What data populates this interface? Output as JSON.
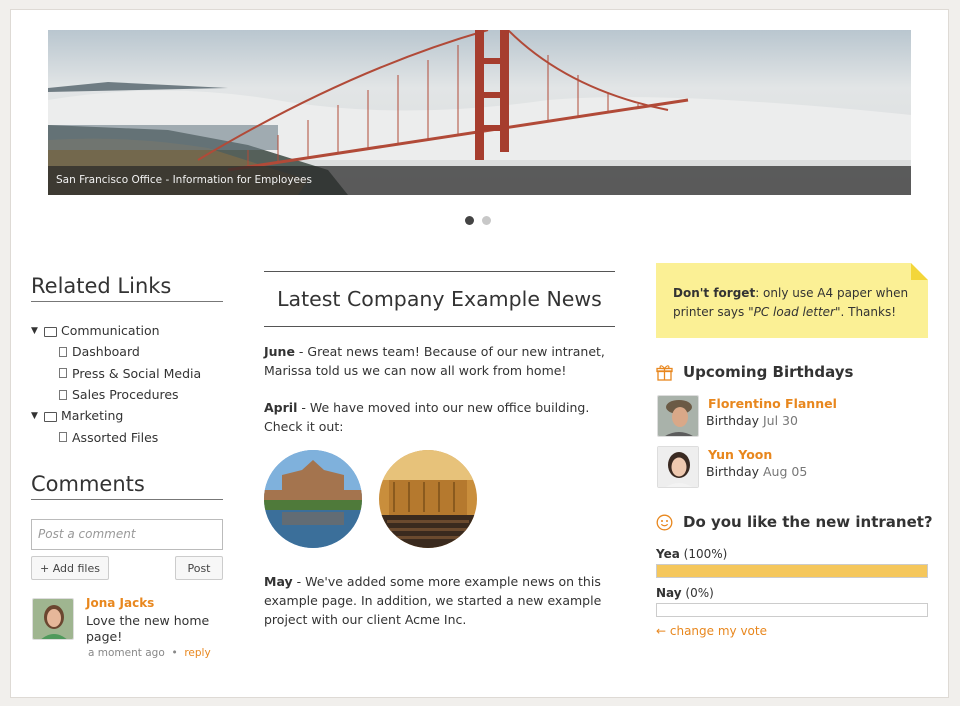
{
  "hero": {
    "caption": "San Francisco Office - Information for Employees",
    "slides": 2,
    "active_slide": 1
  },
  "related_links": {
    "title": "Related Links",
    "groups": [
      {
        "label": "Communication",
        "items": [
          "Dashboard",
          "Press & Social Media",
          "Sales Procedures"
        ]
      },
      {
        "label": "Marketing",
        "items": [
          "Assorted Files"
        ]
      }
    ]
  },
  "comments": {
    "title": "Comments",
    "placeholder": "Post a comment",
    "add_files_label": "+ Add files",
    "post_label": "Post",
    "items": [
      {
        "author": "Jona Jacks",
        "text": "Love the new home page!",
        "time": "a moment ago",
        "separator": "•",
        "reply_label": "reply"
      }
    ]
  },
  "news": {
    "title": "Latest Company Example News",
    "entries": [
      {
        "month": "June",
        "text": " - Great news team! Because of our new intranet, Marissa told us we can now all work from home!"
      },
      {
        "month": "April",
        "text": " - We have moved into our new office building. Check it out:"
      },
      {
        "month": "May",
        "text": " - We've added some more example news on this example page. In addition, we started a new example project with our client Acme Inc."
      }
    ]
  },
  "note": {
    "bold": "Don't forget",
    "text_before": ": only use A4 paper when printer says \"",
    "italic": "PC load letter",
    "text_after": "\". Thanks!"
  },
  "birthdays": {
    "title": "Upcoming Birthdays",
    "icon": "gift-icon",
    "people": [
      {
        "name": "Florentino Flannel",
        "label": "Birthday",
        "date": "Jul 30"
      },
      {
        "name": "Yun Yoon",
        "label": "Birthday",
        "date": "Aug 05"
      }
    ]
  },
  "poll": {
    "title": "Do you like the new intranet?",
    "icon": "smiley-icon",
    "options": [
      {
        "label": "Yea",
        "percent_text": "(100%)",
        "fraction": 1.0
      },
      {
        "label": "Nay",
        "percent_text": "(0%)",
        "fraction": 0.0
      }
    ],
    "change_vote": "← change my vote"
  },
  "colors": {
    "accent": "#e8871e",
    "note_bg": "#fbf095",
    "bar_fill": "#f5c75c"
  }
}
